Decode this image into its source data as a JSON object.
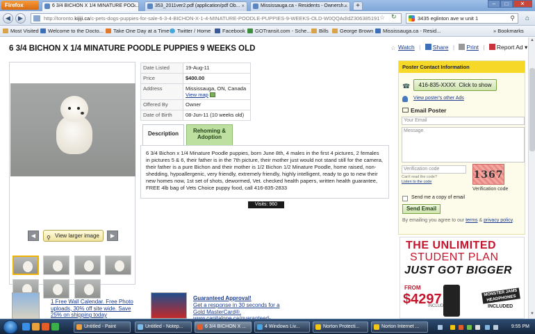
{
  "browser": {
    "app_button": "Firefox",
    "tabs": [
      {
        "label": "6 3/4 BICHON X 1/4 MINATURE POO...",
        "active": true
      },
      {
        "label": "353_2011ver2.pdf (application/pdf Ob...",
        "active": false
      },
      {
        "label": "Mississauga.ca - Residents - Ownersh...",
        "active": false
      }
    ],
    "new_tab": "+",
    "url_prefix": "http://toronto.",
    "url_domain": "kijiji.ca",
    "url_rest": "/c-pets-dogs-puppies-for-sale-6-3-4-BICHON-X-1-4-MINATURE-POODLE-PUPPIES-9-WEEKS-OLD-W0QQAdIdZ306385191",
    "search_value": "3435 eglinton ave w unit 1",
    "bookmarks": [
      {
        "label": "Most Visited",
        "style": ""
      },
      {
        "label": "Welcome to the Docto...",
        "style": "blue"
      },
      {
        "label": "Take One Day at a Time",
        "style": "org"
      },
      {
        "label": "Twitter / Home",
        "style": "tw"
      },
      {
        "label": "Facebook",
        "style": "fb"
      },
      {
        "label": "GOTransit.com - Sche...",
        "style": "grn"
      },
      {
        "label": "Bills",
        "style": ""
      },
      {
        "label": "George Brown",
        "style": ""
      },
      {
        "label": "Mississauga.ca - Resid...",
        "style": "blue"
      }
    ],
    "bookmarks_menu": "» Bookmarks"
  },
  "listing": {
    "title": "6 3/4 BICHON X 1/4 MINATURE POODLE PUPPIES 9 WEEKS OLD",
    "actions": {
      "watch": "Watch",
      "share": "Share",
      "print": "Print",
      "report": "Report Ad"
    },
    "view_larger": "View larger image",
    "details": [
      {
        "key": "Date Listed",
        "value": "19-Aug-11"
      },
      {
        "key": "Price",
        "value": "$400.00"
      },
      {
        "key": "Address",
        "value": "Mississauga, ON, Canada",
        "link": "View map"
      },
      {
        "key": "Offered By",
        "value": "Owner"
      },
      {
        "key": "Date of Birth",
        "value": "08-Jun-11   (10 weeks old)"
      }
    ],
    "tab_description": "Description",
    "tab_rehoming": "Rehoming & Adoption",
    "description": "6 3/4 Bichon x 1/4 Minature Poodle puppies, born June 8th, 4 males in the first 4 pictures, 2 females in pictures 5 & 6, their father is in the 7th picture, their mother just would not stand still for the camera, their father is a pure Bichon and their mother is 1/2 Bichon 1/2 Minature Poodle, home raised, non-shedding, hypoallergenic, very friendly, extremely friendly, highly intelligent, ready to go to new their new homes now, 1st set of shots, dewormed, Vet. checked health papers, written health guarantee, FREE 4lb bag of Vets Choice puppy food, call  416-835-2833",
    "visits": "Visits: 960"
  },
  "contact": {
    "header": "Poster Contact Information",
    "phone": "416-835-XXXX",
    "phone_action": "Click to show",
    "other_ads": "View poster's other Ads",
    "email_poster": "Email Poster",
    "email_placeholder": "Your Email",
    "message_placeholder": "Message",
    "verif_placeholder": "Verification code",
    "cant_read": "Can't read the code?",
    "listen": "Listen to the code",
    "captcha": "1367",
    "verif_label": "Verification code",
    "copy_label": "Send me a copy of email",
    "send_button": "Send Email",
    "terms_prefix": "By emailing you agree to our",
    "terms_link": "terms",
    "amp": "&",
    "privacy_link": "privacy policy",
    "terms_suffix": "."
  },
  "ad": {
    "line1": "THE UNLIMITED",
    "line2": "STUDENT PLAN",
    "line3": "JUST GOT BIGGER",
    "from": "FROM",
    "price": "$4297",
    "fine": "INCLUDES ALL",
    "side": "MONSTER JAMS HEADPHONES",
    "included": "INCLUDED"
  },
  "promos": {
    "p1": "1 Free Wall Calendar. Free Photo uploads, 30% off site wide. Save 25% on shipping today",
    "p2_title": "Guaranteed Approval!",
    "p2_text": "Get a response in 30 seconds for a Gold MasterCard®. www.capitalone.ca/guaranteed-"
  },
  "taskbar": {
    "items": [
      {
        "label": "Untitled - Paint",
        "active": false
      },
      {
        "label": "Untitled - Notep...",
        "active": false
      },
      {
        "label": "6 3/4 BICHON X ...",
        "active": true
      },
      {
        "label": "4 Windows Liv...",
        "active": false
      },
      {
        "label": "Norton Protecti...",
        "active": false
      },
      {
        "label": "Norton Internet ...",
        "active": false
      }
    ],
    "clock": "9:55 PM"
  }
}
